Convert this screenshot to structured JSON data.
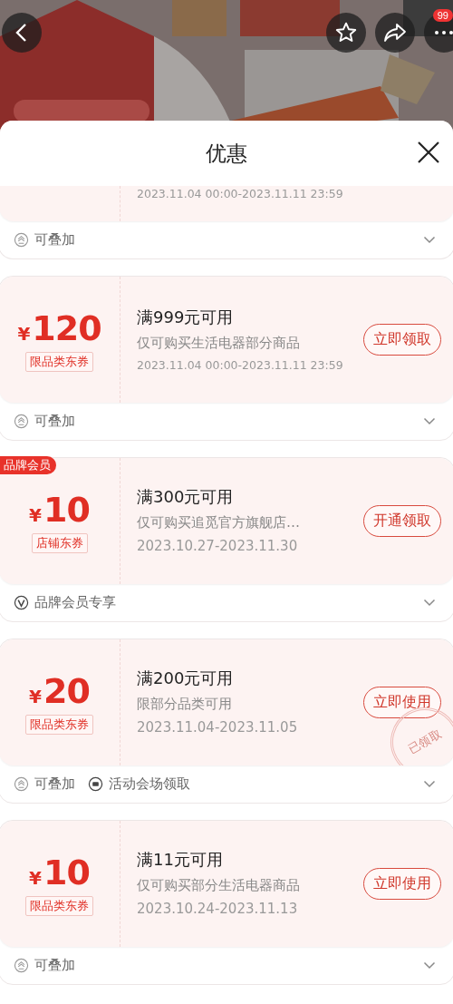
{
  "top_bar": {
    "badge": "99"
  },
  "sheet": {
    "title": "优惠"
  },
  "coupons": [
    {
      "partial": true,
      "validity": "2023.11.04 00:00-2023.11.11 23:59",
      "tags": [
        {
          "kind": "stack",
          "label": "可叠加"
        }
      ]
    },
    {
      "partial": false,
      "currency": "¥",
      "amount": "120",
      "type_tag": "限品类东券",
      "title": "满999元可用",
      "description": "仅可购买生活电器部分商品",
      "validity": "2023.11.04 00:00-2023.11.11 23:59",
      "action": "立即领取",
      "tags": [
        {
          "kind": "stack",
          "label": "可叠加"
        }
      ]
    },
    {
      "partial": false,
      "corner_badge": "品牌会员",
      "currency": "¥",
      "amount": "10",
      "type_tag": "店铺东券",
      "title": "满300元可用",
      "description": "仅可购买追觅官方旗舰店…",
      "validity": "2023.10.27-2023.11.30",
      "action": "开通领取",
      "tags": [
        {
          "kind": "brand",
          "label": "品牌会员专享"
        }
      ]
    },
    {
      "partial": false,
      "stamp": "已领取",
      "currency": "¥",
      "amount": "20",
      "type_tag": "限品类东券",
      "title": "满200元可用",
      "description": "限部分品类可用",
      "validity": "2023.11.04-2023.11.05",
      "action": "立即使用",
      "tags": [
        {
          "kind": "stack",
          "label": "可叠加"
        },
        {
          "kind": "venue",
          "label": "活动会场领取"
        }
      ]
    },
    {
      "partial": false,
      "currency": "¥",
      "amount": "10",
      "type_tag": "限品类东券",
      "title": "满11元可用",
      "description": "仅可购买部分生活电器商品",
      "validity": "2023.10.24-2023.11.13",
      "action": "立即使用",
      "tags": [
        {
          "kind": "stack",
          "label": "可叠加"
        }
      ]
    }
  ]
}
